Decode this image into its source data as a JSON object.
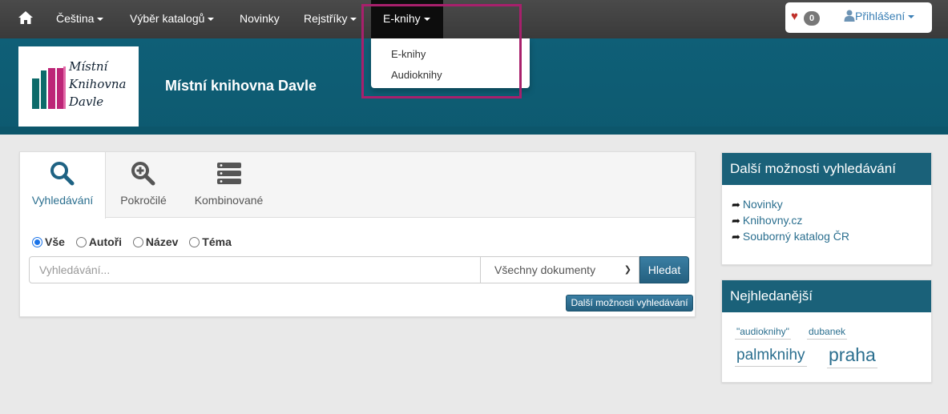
{
  "nav": {
    "home_icon": "home-icon",
    "items": [
      {
        "label": "Čeština",
        "dropdown": true
      },
      {
        "label": "Výběr katalogů",
        "dropdown": true
      },
      {
        "label": "Novinky",
        "dropdown": false
      },
      {
        "label": "Rejstříky",
        "dropdown": true
      },
      {
        "label": "E-knihy",
        "dropdown": true,
        "active": true
      }
    ],
    "favorites_count": "0",
    "login_label": "Přihlášení"
  },
  "banner": {
    "title": "Místní knihovna Davle",
    "logo_text": [
      "Místní",
      "Knihovna",
      "Davle"
    ]
  },
  "dropdown": {
    "items": [
      "E-knihy",
      "Audioknihy"
    ]
  },
  "search": {
    "tabs": [
      {
        "label": "Vyhledávání",
        "icon": "search-icon",
        "active": true
      },
      {
        "label": "Pokročilé",
        "icon": "zoom-in-icon",
        "active": false
      },
      {
        "label": "Kombinované",
        "icon": "server-icon",
        "active": false
      }
    ],
    "radios": [
      {
        "label": "Vše",
        "checked": true
      },
      {
        "label": "Autoři",
        "checked": false
      },
      {
        "label": "Název",
        "checked": false
      },
      {
        "label": "Téma",
        "checked": false
      }
    ],
    "placeholder": "Vyhledávání...",
    "doc_type": "Všechny dokumenty",
    "submit_label": "Hledat",
    "more_label": "Další možnosti vyhledávání"
  },
  "sidebar": {
    "more_title": "Další možnosti vyhledávání",
    "links": [
      "Novinky",
      "Knihovny.cz",
      "Souborný katalog ČR"
    ],
    "popular_title": "Nejhledanější",
    "tags": [
      "\"audioknihy\"",
      "dubanek",
      "palmknihy",
      "praha"
    ]
  },
  "colors": {
    "banner": "#0f5f77",
    "accent": "#2b6f8f",
    "highlight": "#a8206c"
  }
}
